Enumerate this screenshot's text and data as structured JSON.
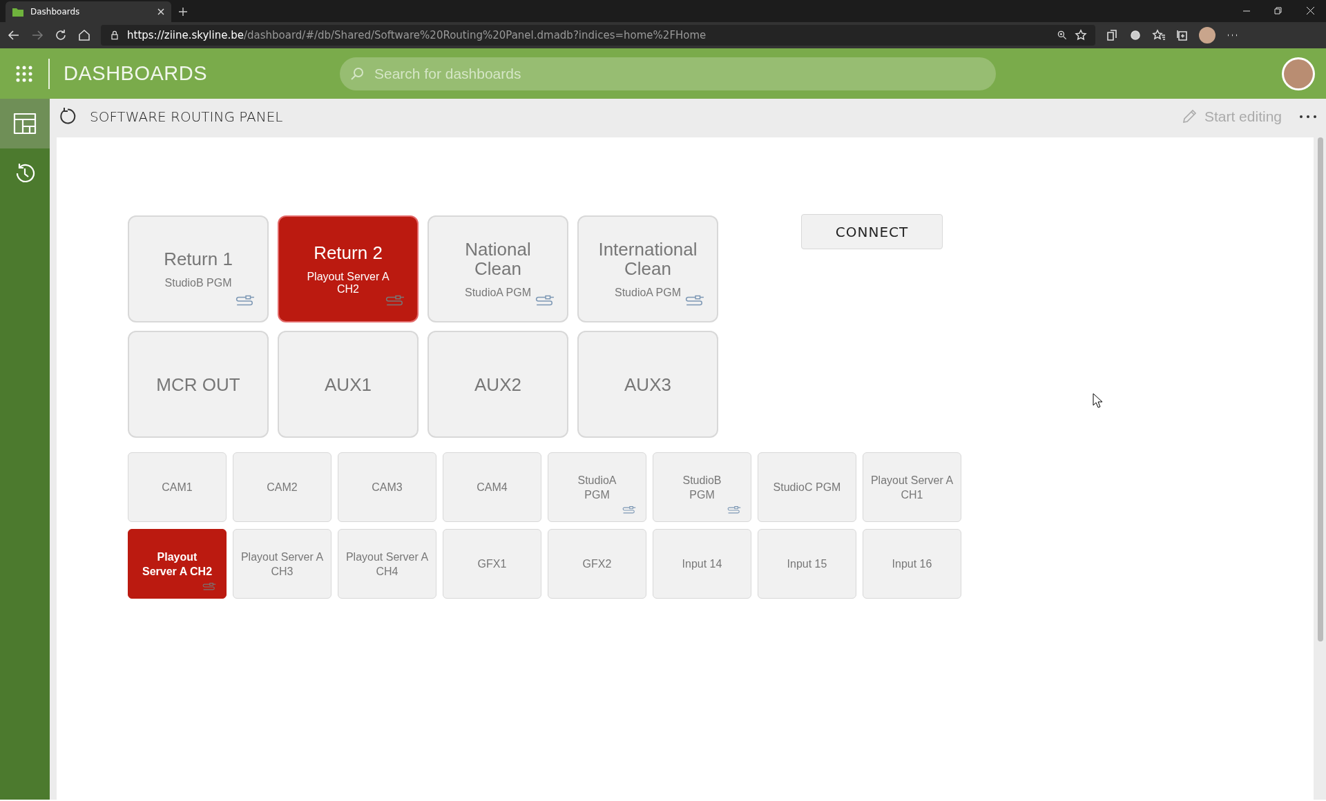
{
  "browser": {
    "tab_title": "Dashboards",
    "url_origin": "https://ziine.skyline.be",
    "url_path": "/dashboard/#/db/Shared/Software%20Routing%20Panel.dmadb?indices=home%2FHome"
  },
  "app_header": {
    "title": "DASHBOARDS",
    "search": {
      "placeholder": "Search for dashboards"
    }
  },
  "sidebar": {
    "items": [
      {
        "kind": "dashboards",
        "selected": true
      },
      {
        "kind": "history",
        "selected": false
      }
    ]
  },
  "toolbar": {
    "title": "SOFTWARE ROUTING PANEL",
    "edit_label": "Start editing"
  },
  "destinations": [
    {
      "label": "Return 1",
      "source": "StudioB PGM",
      "selected": false,
      "connected": true
    },
    {
      "label": "Return 2",
      "source": "Playout Server A CH2",
      "selected": true,
      "connected": true
    },
    {
      "label": "National Clean",
      "source": "StudioA PGM",
      "selected": false,
      "connected": true
    },
    {
      "label": "International Clean",
      "source": "StudioA PGM",
      "selected": false,
      "connected": true
    },
    {
      "label": "MCR OUT",
      "selected": false,
      "connected": false
    },
    {
      "label": "AUX1",
      "selected": false,
      "connected": false
    },
    {
      "label": "AUX2",
      "selected": false,
      "connected": false
    },
    {
      "label": "AUX3",
      "selected": false,
      "connected": false
    }
  ],
  "connect_button": "CONNECT",
  "sources": [
    {
      "label": "CAM1",
      "selected": false,
      "connected": false
    },
    {
      "label": "CAM2",
      "selected": false,
      "connected": false
    },
    {
      "label": "CAM3",
      "selected": false,
      "connected": false
    },
    {
      "label": "CAM4",
      "selected": false,
      "connected": false
    },
    {
      "label": "StudioA PGM",
      "selected": false,
      "connected": true
    },
    {
      "label": "StudioB PGM",
      "selected": false,
      "connected": true
    },
    {
      "label": "StudioC PGM",
      "selected": false,
      "connected": false
    },
    {
      "label": "Playout Server A CH1",
      "selected": false,
      "connected": false
    },
    {
      "label": "Playout Server A CH2",
      "selected": true,
      "connected": true
    },
    {
      "label": "Playout Server A CH3",
      "selected": false,
      "connected": false
    },
    {
      "label": "Playout Server A CH4",
      "selected": false,
      "connected": false
    },
    {
      "label": "GFX1",
      "selected": false,
      "connected": false
    },
    {
      "label": "GFX2",
      "selected": false,
      "connected": false
    },
    {
      "label": "Input 14",
      "selected": false,
      "connected": false
    },
    {
      "label": "Input 15",
      "selected": false,
      "connected": false
    },
    {
      "label": "Input 16",
      "selected": false,
      "connected": false
    }
  ]
}
